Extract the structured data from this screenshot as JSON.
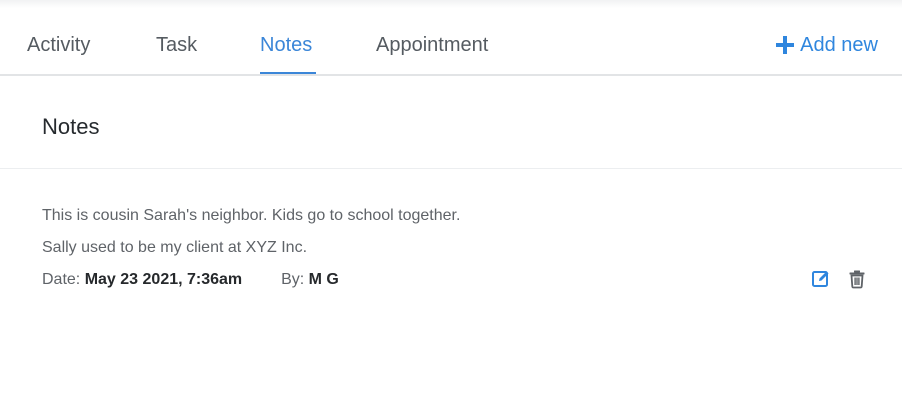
{
  "tabs": [
    {
      "label": "Activity",
      "active": false
    },
    {
      "label": "Task",
      "active": false
    },
    {
      "label": "Notes",
      "active": true
    },
    {
      "label": "Appointment",
      "active": false
    }
  ],
  "add_new": {
    "label": "Add new",
    "icon": "plus-icon"
  },
  "section": {
    "title": "Notes"
  },
  "note": {
    "lines": [
      "This is cousin Sarah's neighbor. Kids go to school together.",
      "Sally used to be my client at XYZ Inc."
    ],
    "date_label": "Date:",
    "date_value": "May 23 2021, 7:36am",
    "by_label": "By:",
    "by_value": "M G",
    "actions": [
      {
        "icon": "edit-icon",
        "color": "#2f86de"
      },
      {
        "icon": "trash-icon",
        "color": "#5f6368"
      }
    ]
  },
  "colors": {
    "accent": "#3b86d8",
    "text_muted": "#5f6368",
    "text_dark": "#26292c"
  }
}
